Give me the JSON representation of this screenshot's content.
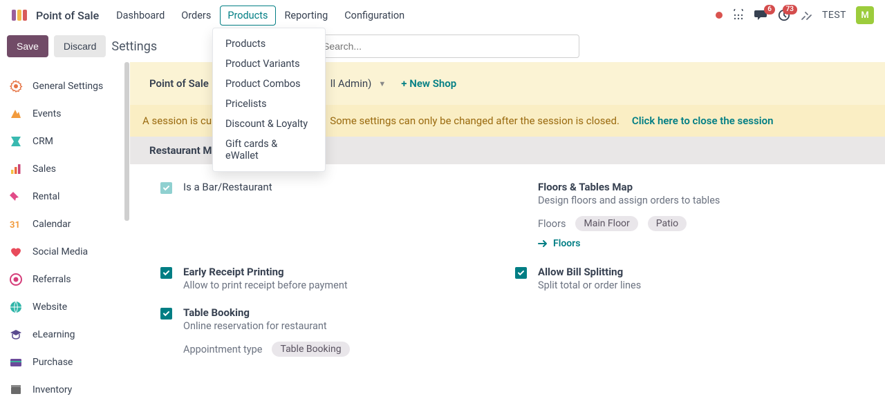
{
  "nav": {
    "brand": "Point of Sale",
    "items": [
      "Dashboard",
      "Orders",
      "Products",
      "Reporting",
      "Configuration"
    ],
    "active_index": 2,
    "dropdown": [
      "Products",
      "Product Variants",
      "Product Combos",
      "Pricelists",
      "Discount & Loyalty",
      "Gift cards & eWallet"
    ]
  },
  "topright": {
    "messages_badge": "6",
    "activity_badge": "73",
    "test_label": "TEST",
    "avatar_initial": "M"
  },
  "actionbar": {
    "save": "Save",
    "discard": "Discard",
    "title": "Settings",
    "search_placeholder": "Search..."
  },
  "sidebar": {
    "items": [
      "General Settings",
      "Events",
      "CRM",
      "Sales",
      "Rental",
      "Calendar",
      "Social Media",
      "Referrals",
      "Website",
      "eLearning",
      "Purchase",
      "Inventory"
    ]
  },
  "posbar": {
    "label": "Point of Sale",
    "value_suffix": "ll Admin)",
    "new_shop": "+ New Shop"
  },
  "session": {
    "prefix": "A session is cur",
    "suffix": "Some settings can only be changed after the session is closed.",
    "link": "Click here to close the session"
  },
  "section": {
    "title": "Restaurant Mode"
  },
  "settings": {
    "is_bar": {
      "title": "Is a Bar/Restaurant"
    },
    "floors": {
      "title": "Floors & Tables Map",
      "desc": "Design floors and assign orders to tables",
      "floors_label": "Floors",
      "tags": [
        "Main Floor",
        "Patio"
      ],
      "link": "Floors"
    },
    "early": {
      "title": "Early Receipt Printing",
      "desc": "Allow to print receipt before payment"
    },
    "split": {
      "title": "Allow Bill Splitting",
      "desc": "Split total or order lines"
    },
    "booking": {
      "title": "Table Booking",
      "desc": "Online reservation for restaurant",
      "appt_label": "Appointment type",
      "appt_tag": "Table Booking"
    }
  }
}
